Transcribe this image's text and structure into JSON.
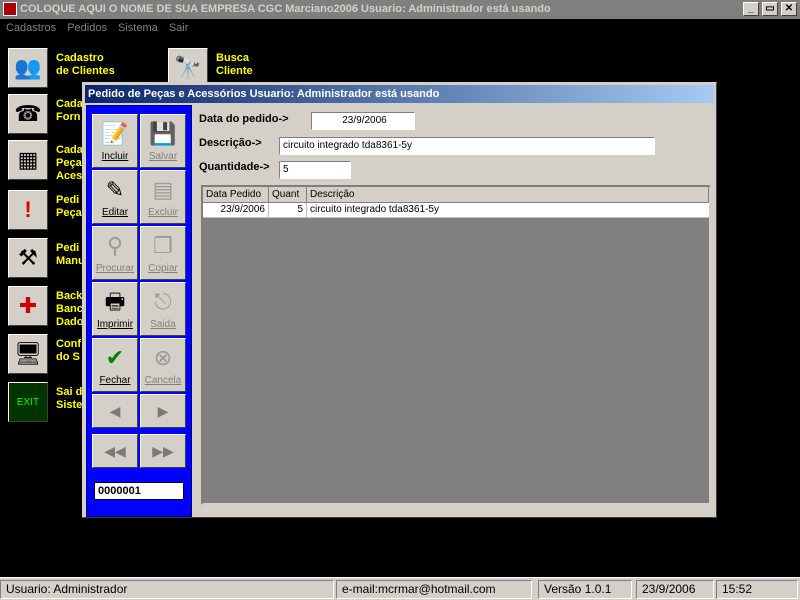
{
  "app": {
    "title": "COLOQUE AQUI O NOME DE SUA EMPRESA    CGC Marciano2006   Usuario: Administrador  está usando",
    "window_buttons": [
      "_",
      "▭",
      "✕"
    ]
  },
  "menu": [
    "Cadastros",
    "Pedidos",
    "Sistema",
    "Sair"
  ],
  "launchers": [
    {
      "label": "Cadastro\nde Clientes",
      "icon": "people-icon"
    },
    {
      "label": "Cada\nForn",
      "icon": "supplier-icon"
    },
    {
      "label": "Cada\nPeça\nAces",
      "icon": "chip-icon"
    },
    {
      "label": "Pedi\nPeça",
      "icon": "alert-icon"
    },
    {
      "label": "Pedi\nManu",
      "icon": "tools-icon"
    },
    {
      "label": "Back\nBanc\nDado",
      "icon": "floppy-icon"
    },
    {
      "label": "Conf\ndo S",
      "icon": "monitor-icon"
    },
    {
      "label": "Sai d\nSiste",
      "icon": "exit-icon"
    },
    {
      "label": "Busca\nCliente",
      "icon": "binoculars-icon"
    }
  ],
  "dialog": {
    "title": "Pedido de Peças e Acessórios      Usuario: Administrador  está usando",
    "toolbar": {
      "incluir": "Incluir",
      "salvar": "Salvar",
      "editar": "Editar",
      "excluir": "Excluir",
      "procurar": "Procurar",
      "copiar": "Copiar",
      "imprimir": "Imprimir",
      "saida": "Saida",
      "fechar": "Fechar",
      "cancela": "Cancela"
    },
    "record_number": "0000001",
    "form": {
      "data_label": "Data do pedido->",
      "data_value": "23/9/2006",
      "descricao_label": "Descrição->",
      "descricao_value": "circuito integrado tda8361-5y",
      "quantidade_label": "Quantidade->",
      "quantidade_value": "5"
    },
    "grid": {
      "columns": [
        "Data Pedido",
        "Quant",
        "Descrição"
      ],
      "rows": [
        [
          "23/9/2006",
          "5",
          "circuito integrado tda8361-5y"
        ]
      ]
    }
  },
  "status": {
    "user": "Usuario: Administrador",
    "email": "e-mail:mcrmar@hotmail.com",
    "version": "Versão 1.0.1",
    "date": "23/9/2006",
    "time": "15:52"
  },
  "colors": {
    "launcher_label": "#ffff00",
    "toolbar_panel": "#0000ff",
    "title_gradient_start": "#0a246a",
    "title_gradient_end": "#a6caf0"
  }
}
